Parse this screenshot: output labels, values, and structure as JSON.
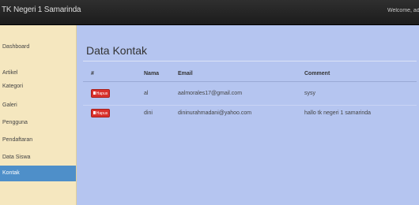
{
  "header": {
    "brand": "TK Negeri 1 Samarinda",
    "welcome": "Welcome, admin"
  },
  "sidebar": {
    "items": [
      {
        "label": "Dashboard"
      },
      {
        "label": "Artikel"
      },
      {
        "label": "Kategori"
      },
      {
        "label": "Galeri"
      },
      {
        "label": "Pengguna"
      },
      {
        "label": "Pendaftaran"
      },
      {
        "label": "Data Siswa"
      },
      {
        "label": "Kontak"
      }
    ],
    "active": "Kontak"
  },
  "main": {
    "title": "Data Kontak",
    "columns": [
      "#",
      "Nama",
      "Email",
      "Comment"
    ],
    "delete_label": "Hapus",
    "rows": [
      {
        "nama": "al",
        "email": "aalmorales17@gmail.com",
        "comment": "sysy"
      },
      {
        "nama": "dini",
        "email": "dininurahmadani@yahoo.com",
        "comment": "hallo tk negeri 1 samarinda"
      }
    ]
  },
  "colors": {
    "topbar": "#1c1c1c",
    "sidebar": "#f5e7bf",
    "active_item": "#4e8fc9",
    "content": "#b5c5f0",
    "delete_button": "#d9312b"
  }
}
